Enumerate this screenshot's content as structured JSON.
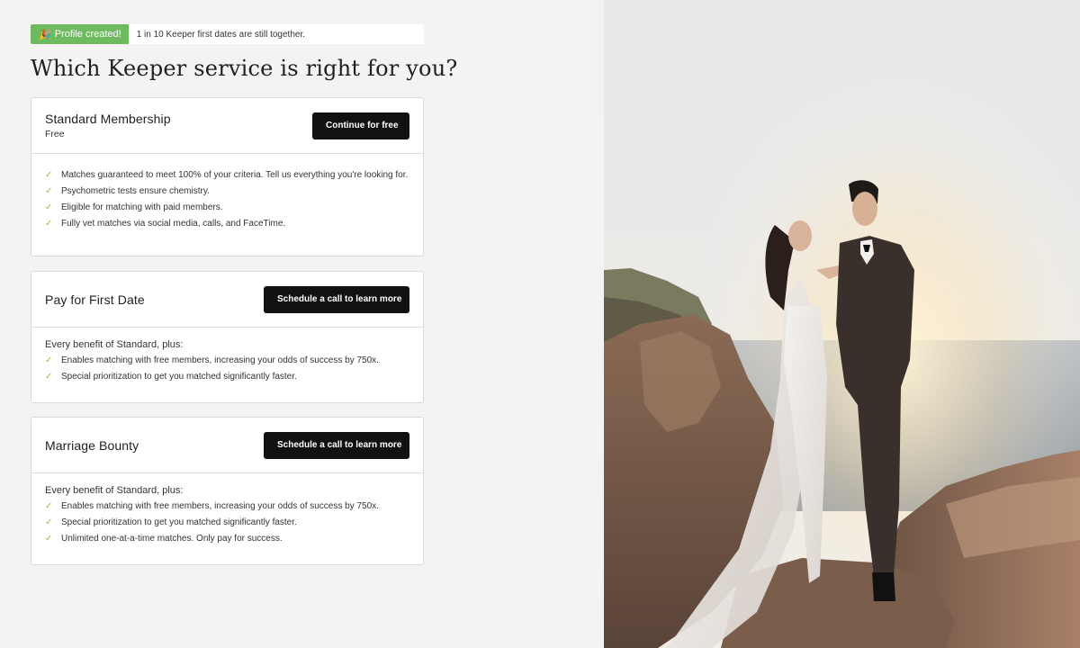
{
  "toast": {
    "badge_icon": "party-popper-icon",
    "badge": "Profile created!",
    "message": "1 in 10 Keeper first dates are still together."
  },
  "page_title": "Which Keeper service is right for you?",
  "plans": [
    {
      "title": "Standard Membership",
      "subtitle": "Free",
      "button": "Continue for free",
      "intro": "",
      "benefits": [
        "Matches guaranteed to meet 100% of your criteria. Tell us everything you're looking for.",
        "Psychometric tests ensure chemistry.",
        "Eligible for matching with paid members.",
        "Fully vet matches via social media, calls, and FaceTime."
      ]
    },
    {
      "title": "Pay for First Date",
      "subtitle": "",
      "button": "Schedule a call to learn more",
      "intro": "Every benefit of Standard, plus:",
      "benefits": [
        "Enables matching with free members, increasing your odds of success by 750x.",
        "Special prioritization to get you matched significantly faster."
      ]
    },
    {
      "title": "Marriage Bounty",
      "subtitle": "",
      "button": "Schedule a call to learn more",
      "intro": "Every benefit of Standard, plus:",
      "benefits": [
        "Enables matching with free members, increasing your odds of success by 750x.",
        "Special prioritization to get you matched significantly faster.",
        "Unlimited one-at-a-time matches. Only pay for success."
      ]
    }
  ],
  "check_icon": "checkmark-icon",
  "colors": {
    "background": "#f4f3f1",
    "accent_green": "#6dbb5e",
    "check_green": "#8bc34a",
    "button": "#111111"
  }
}
